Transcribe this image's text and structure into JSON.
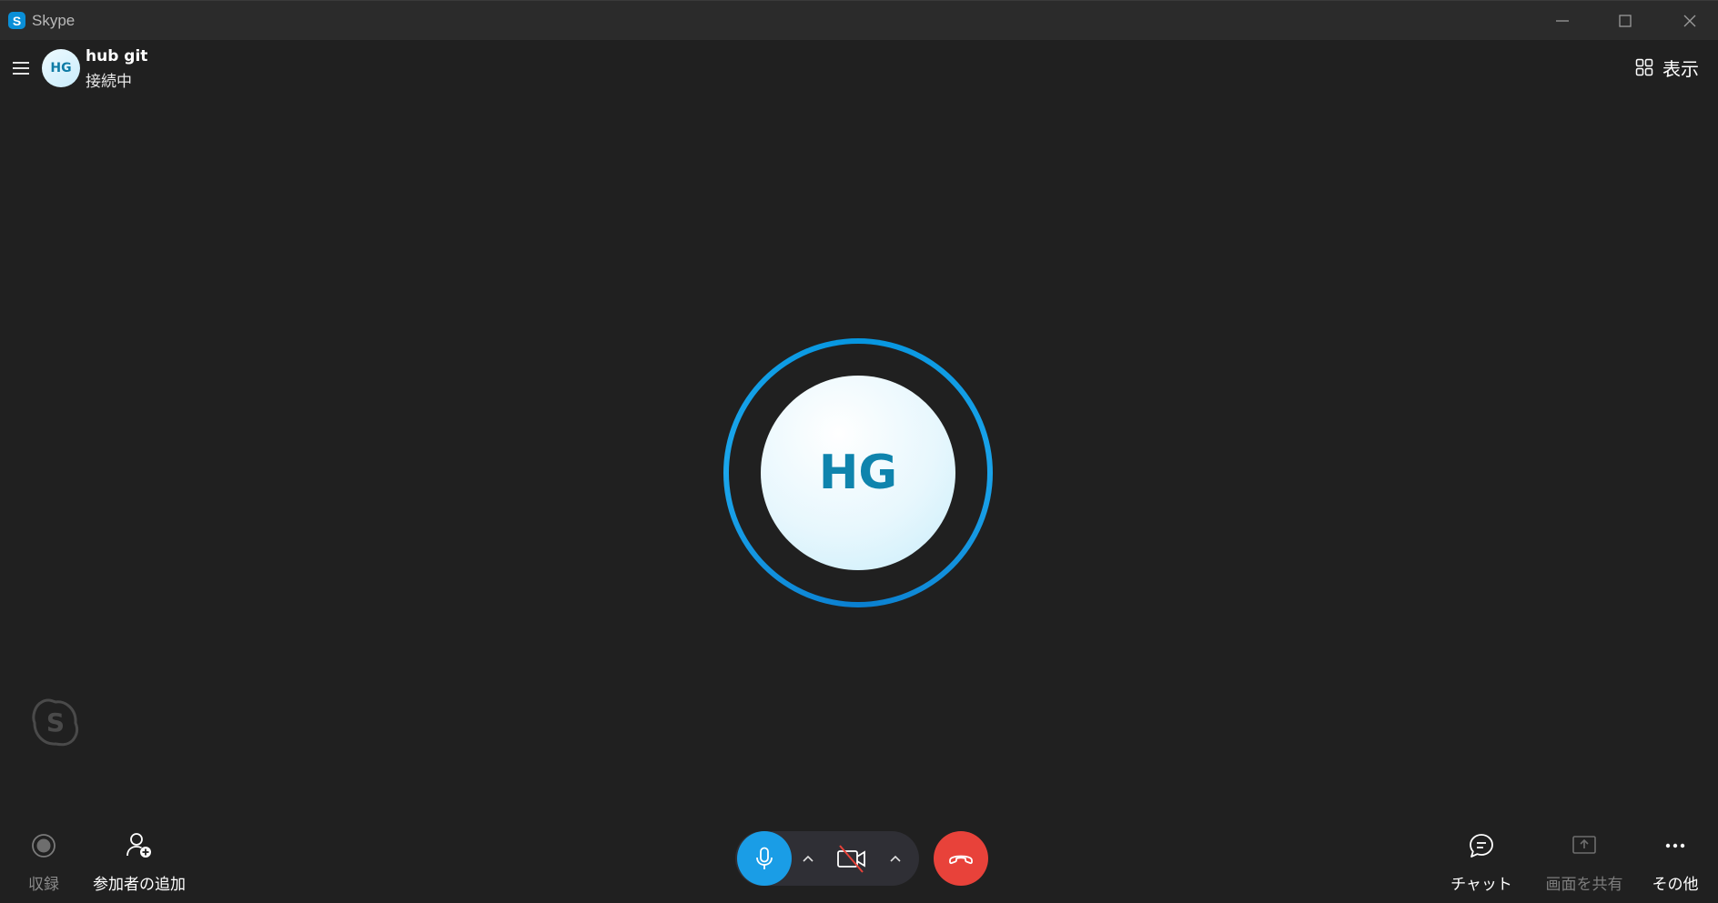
{
  "titlebar": {
    "app_logo": "S",
    "app_title": "Skype"
  },
  "header": {
    "avatar_initials": "HG",
    "contact_name": "hub git",
    "contact_status": "接続中",
    "view_label": "表示"
  },
  "call": {
    "avatar_initials": "HG"
  },
  "toolbar": {
    "record_label": "収録",
    "add_participant_label": "参加者の追加",
    "chat_label": "チャット",
    "share_screen_label": "画面を共有",
    "more_label": "その他"
  },
  "colors": {
    "background": "#202020",
    "accent": "#1a9de6",
    "hangup": "#e8423a",
    "avatar_text": "#0f84ad"
  },
  "icons": {
    "menu": "hamburger-icon",
    "view": "grid-icon",
    "record": "record-icon",
    "add_participant": "person-add-icon",
    "mic": "microphone-icon",
    "camera": "camera-off-icon",
    "hangup": "hangup-icon",
    "chat": "chat-icon",
    "share": "share-screen-icon",
    "more": "more-icon"
  }
}
